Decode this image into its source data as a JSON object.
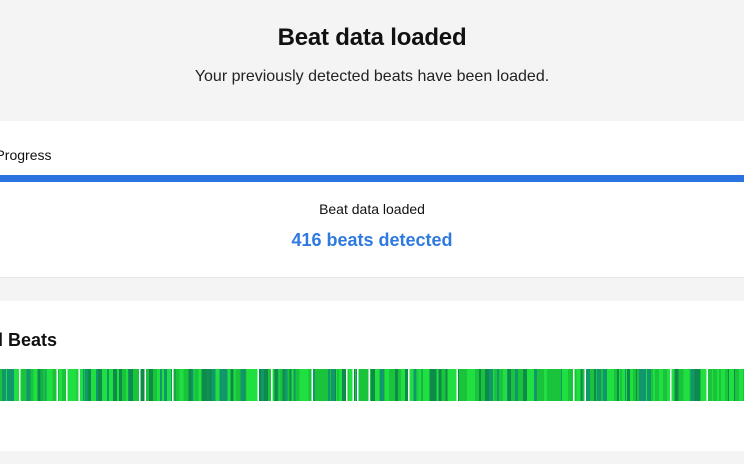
{
  "header": {
    "title": "Beat data loaded",
    "subtitle": "Your previously detected beats have been loaded."
  },
  "progress": {
    "card_title": "on Progress",
    "percent": 100,
    "status": "Beat data loaded",
    "count_label": "416 beats detected"
  },
  "beats": {
    "card_title": "ted Beats",
    "colors": {
      "bright": "#1fe040",
      "mid": "#19c43a",
      "teal": "#11966e",
      "deep": "#0e8a4a",
      "progress": "#2b73e0",
      "count_text": "#2f7ae0"
    }
  }
}
